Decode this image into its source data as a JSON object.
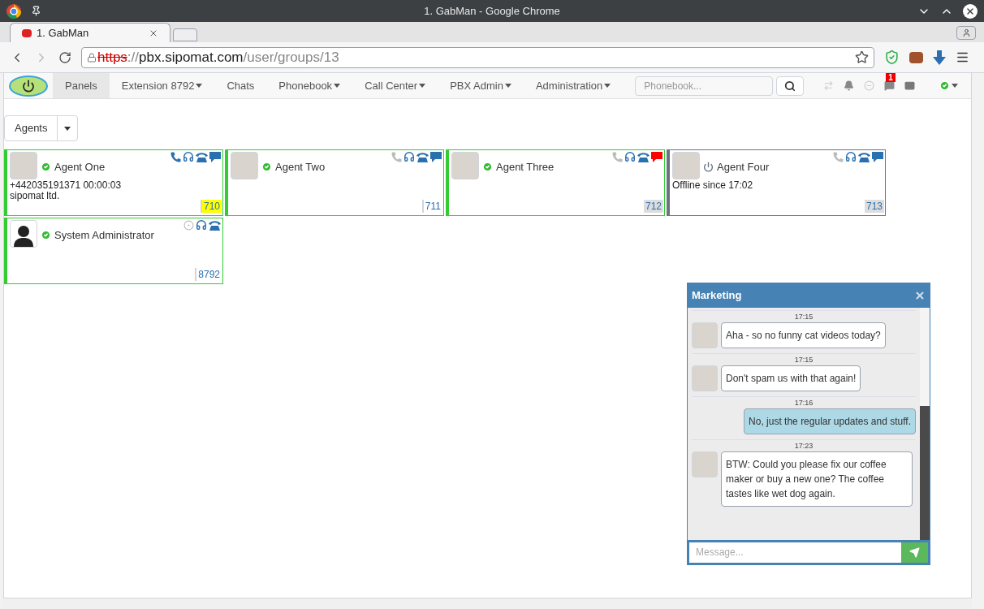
{
  "window": {
    "title": "1. GabMan - Google Chrome"
  },
  "browser_tab": {
    "label": "1. GabMan",
    "selected": true
  },
  "address": {
    "scheme": "https",
    "separator": "://",
    "host": "pbx.sipomat.com",
    "path": "/user/groups/13"
  },
  "navbar": {
    "items": [
      {
        "label": "Panels",
        "selected": true,
        "dropdown": false
      },
      {
        "label": "Extension 8792",
        "selected": false,
        "dropdown": true
      },
      {
        "label": "Chats",
        "selected": false,
        "dropdown": false
      },
      {
        "label": "Phonebook",
        "selected": false,
        "dropdown": true
      },
      {
        "label": "Call Center",
        "selected": false,
        "dropdown": true
      },
      {
        "label": "PBX Admin",
        "selected": false,
        "dropdown": true
      },
      {
        "label": "Administration",
        "selected": false,
        "dropdown": true
      }
    ],
    "search": {
      "placeholder": "Phonebook..."
    },
    "chat_badge": "1"
  },
  "group_select": {
    "label": "Agents"
  },
  "agents": [
    {
      "name": "Agent One",
      "online": true,
      "photo": true,
      "lines": [
        "+442035191371 00:00:03",
        "sipomat ltd."
      ],
      "extension": "710",
      "ringing": true,
      "shaded": false,
      "icons": [
        {
          "kind": "phone",
          "active": true
        },
        {
          "kind": "headset"
        },
        {
          "kind": "desk_phone"
        },
        {
          "kind": "chat",
          "unread": false
        }
      ]
    },
    {
      "name": "Agent Two",
      "online": true,
      "photo": true,
      "extension": "711",
      "ringing": false,
      "shaded": false,
      "icons": [
        {
          "kind": "phone",
          "active": false
        },
        {
          "kind": "headset"
        },
        {
          "kind": "desk_phone"
        },
        {
          "kind": "chat",
          "unread": false
        }
      ]
    },
    {
      "name": "Agent Three",
      "online": true,
      "photo": true,
      "extension": "712",
      "ringing": false,
      "shaded": true,
      "icons": [
        {
          "kind": "phone",
          "active": false
        },
        {
          "kind": "headset"
        },
        {
          "kind": "desk_phone"
        },
        {
          "kind": "chat",
          "unread": true
        }
      ]
    },
    {
      "name": "Agent Four",
      "online": false,
      "photo": true,
      "lines": [
        "Offline since 17:02"
      ],
      "extension": "713",
      "ringing": false,
      "shaded": true,
      "icons": [
        {
          "kind": "phone",
          "active": false
        },
        {
          "kind": "headset"
        },
        {
          "kind": "desk_phone"
        },
        {
          "kind": "chat",
          "unread": false
        }
      ]
    },
    {
      "name": "System Administrator",
      "online": true,
      "photo": false,
      "extension": "8792",
      "ringing": false,
      "shaded": false,
      "icons": [
        {
          "kind": "target"
        },
        {
          "kind": "headset"
        },
        {
          "kind": "desk_phone"
        }
      ]
    }
  ],
  "chat": {
    "title": "Marketing",
    "messages": [
      {
        "time": "17:15",
        "kind": "incoming",
        "text": "Aha - so no funny cat videos today?"
      },
      {
        "time": "17:15",
        "kind": "incoming",
        "text": "Don't spam us with that again!"
      },
      {
        "time": "17:16",
        "kind": "outgoing",
        "text": "No, just the regular updates and stuff."
      },
      {
        "time": "17:23",
        "kind": "incoming",
        "text": "BTW: Could you please fix our coffee maker or buy a new one? The coffee tastes like wet dog again."
      }
    ],
    "input": {
      "placeholder": "Message..."
    }
  }
}
